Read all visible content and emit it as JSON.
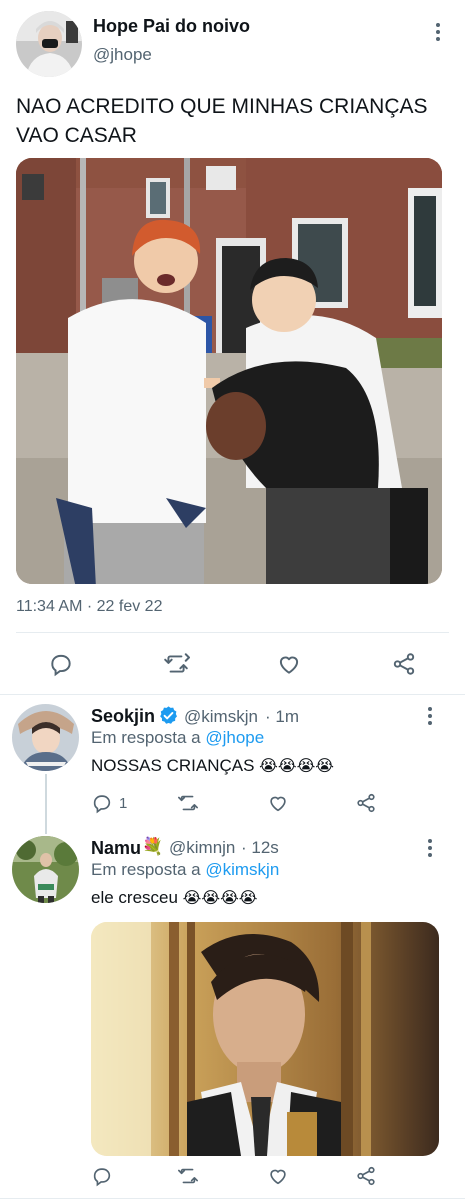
{
  "main_tweet": {
    "display_name": "Hope Pai do noivo",
    "handle": "@jhope",
    "text_line1": "NAO ACREDITO QUE MINHAS CRIANÇAS",
    "text_line2": "VAO CASAR",
    "timestamp": "11:34 AM · 22 fev 22"
  },
  "reply1": {
    "display_name": "Seokjin",
    "verified": true,
    "handle": "@kimskjn",
    "time": "· 1m",
    "reply_prefix": "Em resposta a",
    "reply_to": "@jhope",
    "text": "NOSSAS CRIANÇAS",
    "emoji": "😭😭😭😭",
    "reply_count": "1"
  },
  "reply2": {
    "display_name": "Namu",
    "name_emoji": "💐",
    "handle": "@kimnjn",
    "time": "· 12s",
    "reply_prefix": "Em resposta a",
    "reply_to": "@kimskjn",
    "text": "ele cresceu",
    "emoji": "😭😭😭😭"
  },
  "icons": [
    "more-icon",
    "reply-icon",
    "retweet-icon",
    "like-icon",
    "share-icon",
    "verified-badge-icon"
  ],
  "colors": {
    "accent": "#1d9bf0",
    "text": "#0f1419",
    "secondary": "#536471",
    "divider": "#e6ecf0"
  }
}
